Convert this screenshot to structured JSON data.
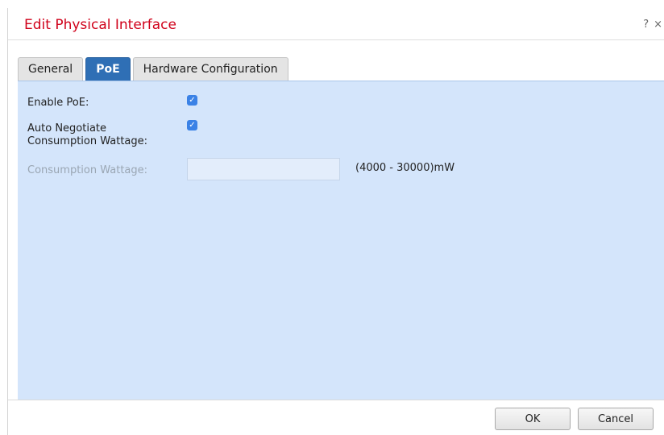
{
  "dialog": {
    "title": "Edit Physical Interface",
    "help_label": "?",
    "close_label": "×",
    "title_color": "#d0021b"
  },
  "tabs": [
    {
      "label": "General",
      "active": false
    },
    {
      "label": "PoE",
      "active": true
    },
    {
      "label": "Hardware Configuration",
      "active": false
    }
  ],
  "form": {
    "enable_poe": {
      "label": "Enable PoE:",
      "checked": true
    },
    "auto_negotiate": {
      "label_line1": "Auto Negotiate",
      "label_line2": "Consumption Wattage:",
      "checked": true
    },
    "consumption_wattage": {
      "label": "Consumption Wattage:",
      "value": "",
      "placeholder": "",
      "range_hint": "(4000 - 30000)mW",
      "disabled": true
    }
  },
  "footer": {
    "ok_label": "OK",
    "cancel_label": "Cancel"
  },
  "colors": {
    "active_tab": "#2f6fb5",
    "panel_background": "#d4e5fb",
    "checkbox": "#3b82e6"
  }
}
